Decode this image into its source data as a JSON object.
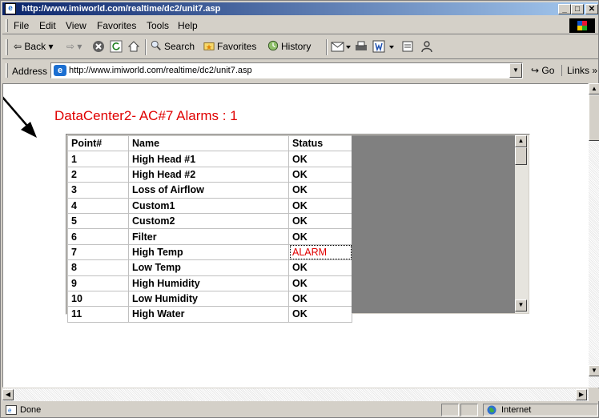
{
  "window": {
    "title": "http://www.imiworld.com/realtime/dc2/unit7.asp",
    "controls": [
      "_",
      "□",
      "✕"
    ]
  },
  "menu": [
    "File",
    "Edit",
    "View",
    "Favorites",
    "Tools",
    "Help"
  ],
  "toolbar": {
    "back": "Back",
    "search": "Search",
    "favorites": "Favorites",
    "history": "History"
  },
  "address": {
    "label": "Address",
    "url": "http://www.imiworld.com/realtime/dc2/unit7.asp",
    "go": "Go",
    "links": "Links »"
  },
  "page": {
    "heading": "DataCenter2- AC#7   Alarms : 1"
  },
  "table": {
    "headers": [
      "Point#",
      "Name",
      "Status"
    ],
    "rows": [
      {
        "point": "1",
        "name": "High Head #1",
        "status": "OK"
      },
      {
        "point": "2",
        "name": "High Head #2",
        "status": "OK"
      },
      {
        "point": "3",
        "name": "Loss of Airflow",
        "status": "OK"
      },
      {
        "point": "4",
        "name": "Custom1",
        "status": "OK"
      },
      {
        "point": "5",
        "name": "Custom2",
        "status": "OK"
      },
      {
        "point": "6",
        "name": "Filter",
        "status": "OK"
      },
      {
        "point": "7",
        "name": "High Temp",
        "status": "ALARM"
      },
      {
        "point": "8",
        "name": "Low Temp",
        "status": "OK"
      },
      {
        "point": "9",
        "name": "High Humidity",
        "status": "OK"
      },
      {
        "point": "10",
        "name": "Low Humidity",
        "status": "OK"
      },
      {
        "point": "11",
        "name": "High Water",
        "status": "OK"
      }
    ]
  },
  "status": {
    "left": "Done",
    "zone": "Internet"
  },
  "colors": {
    "heading": "#e00000",
    "alarm": "#e00000",
    "chrome": "#d4d0c8"
  }
}
